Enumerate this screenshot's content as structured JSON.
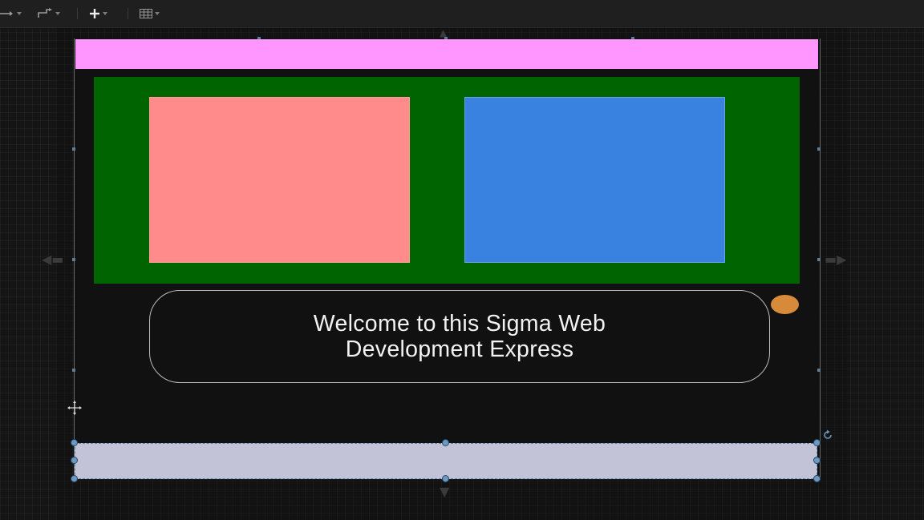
{
  "toolbar": {
    "items": [
      {
        "icon": "line-arrow-icon",
        "has_dropdown": true
      },
      {
        "icon": "connector-icon",
        "has_dropdown": true
      },
      {
        "icon": "plus-icon",
        "has_dropdown": true
      },
      {
        "icon": "table-icon",
        "has_dropdown": true
      }
    ]
  },
  "canvas": {
    "welcome_box": {
      "line1": "Welcome to this Sigma Web",
      "line2": "Development Express"
    }
  },
  "colors": {
    "header_bar": "#ff96ff",
    "green_panel": "#006400",
    "pink_box": "#ff8c8a",
    "blue_box": "#3a82e0",
    "orange_dot": "#d78a3a",
    "footer_bar": "#c3c3d8",
    "selection_handle": "#6a9ac4"
  },
  "selection": {
    "selected_element": "footer-bar",
    "handles": 8
  }
}
